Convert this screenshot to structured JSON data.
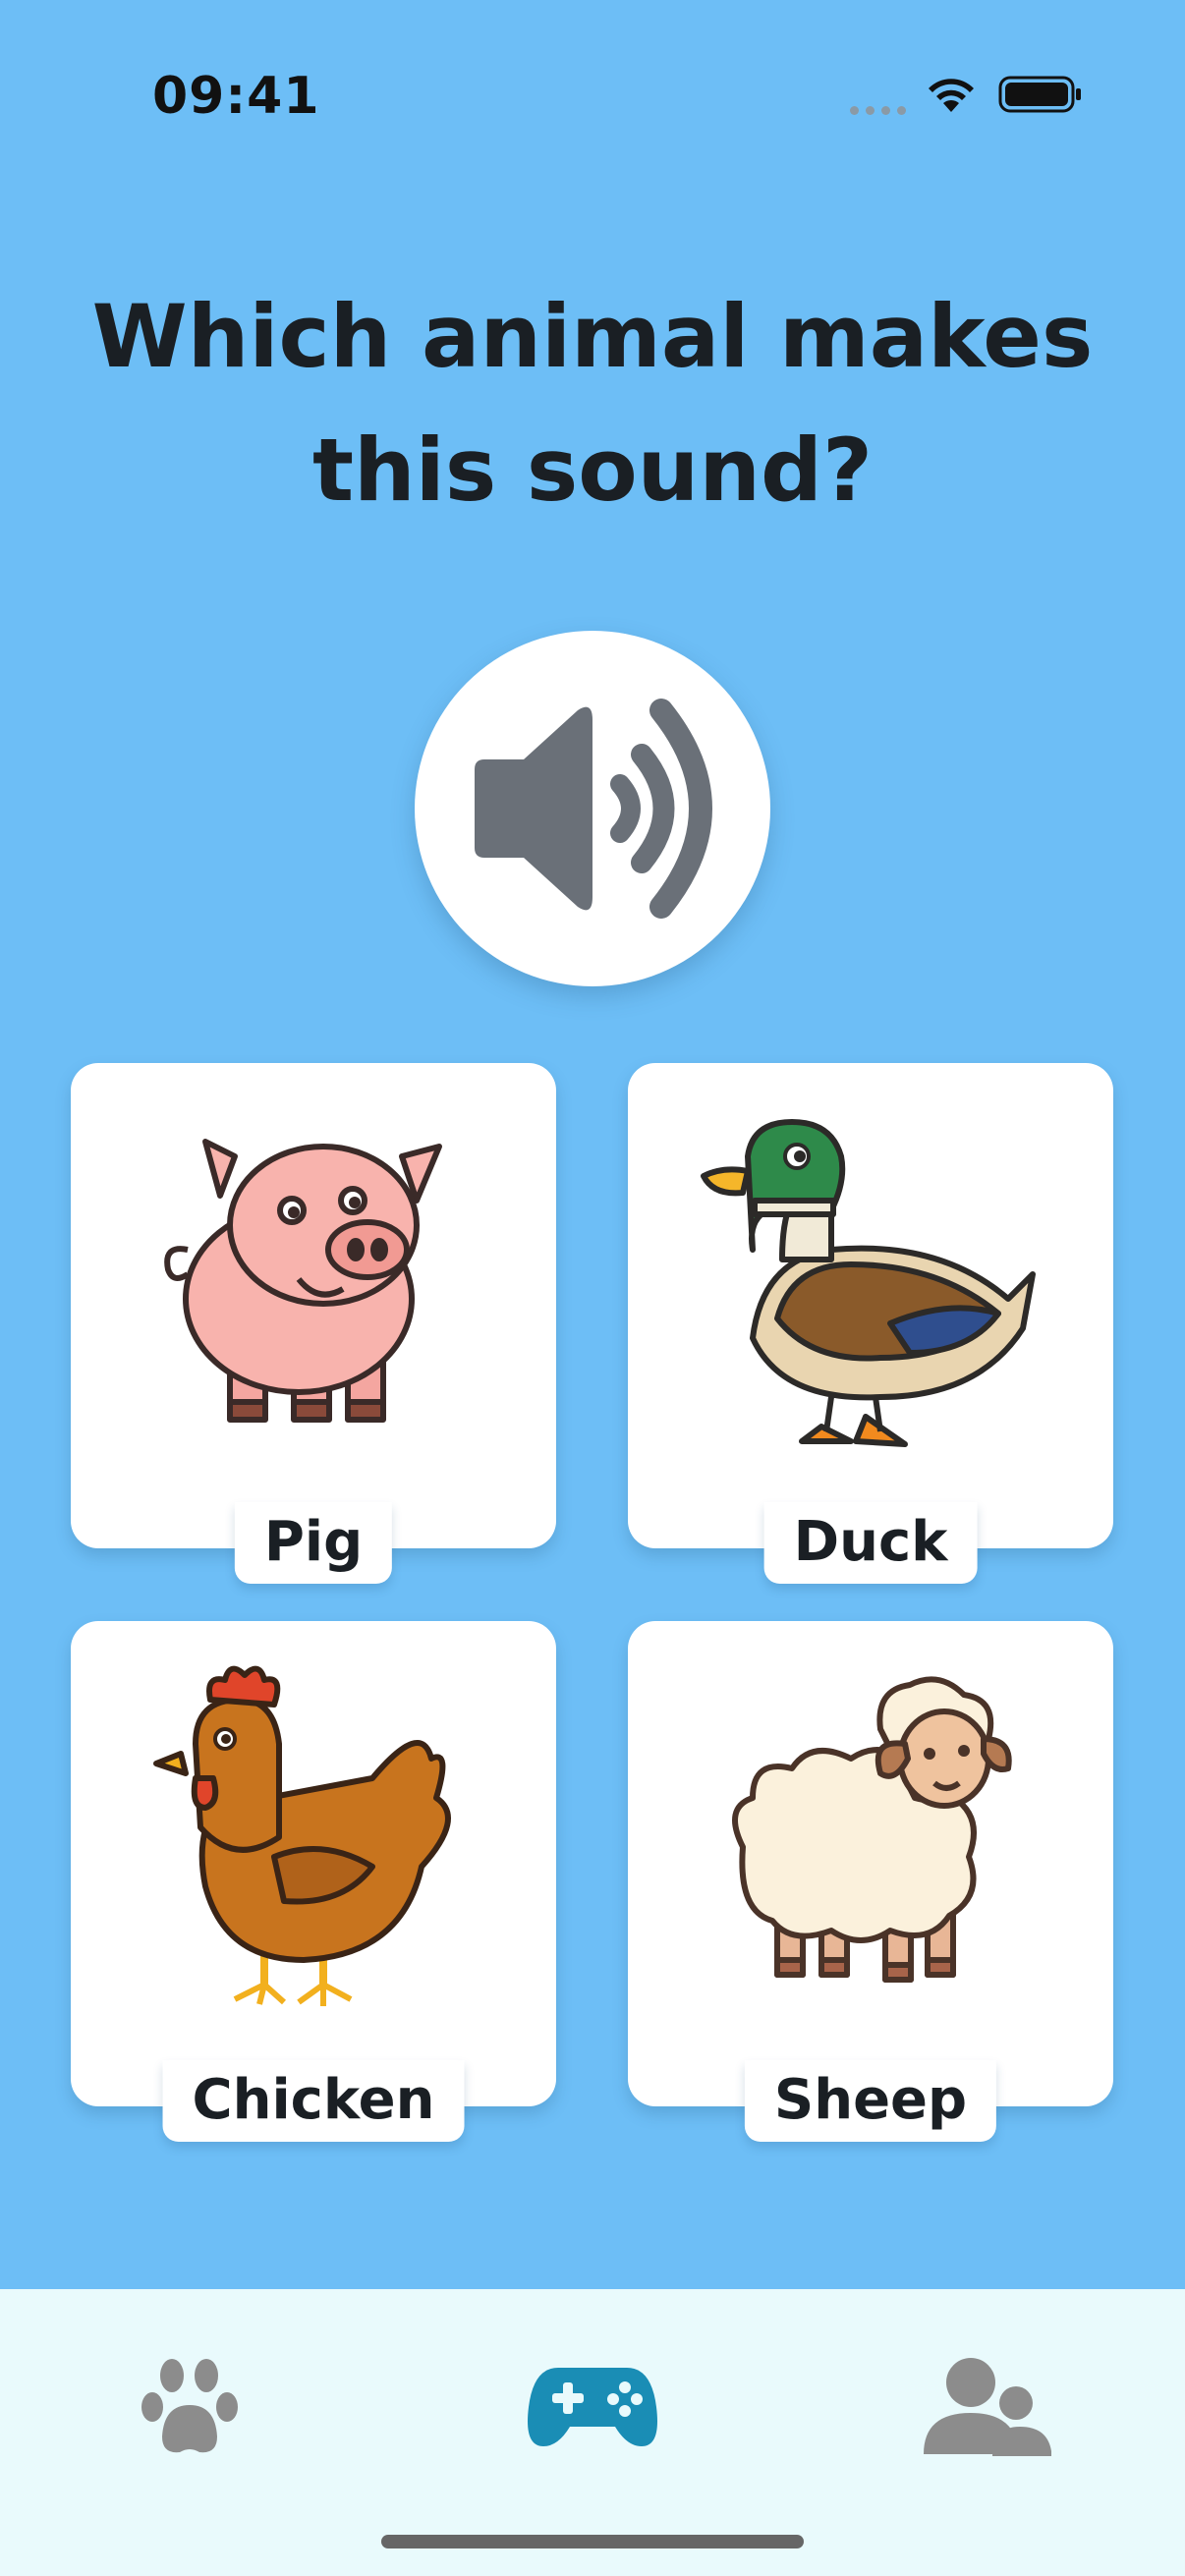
{
  "status_bar": {
    "time": "09:41",
    "icons": [
      "cellular-dots-icon",
      "wifi-icon",
      "battery-icon"
    ]
  },
  "question": {
    "title": "Which animal makes this sound?"
  },
  "sound_button": {
    "icon": "speaker-icon"
  },
  "choices": [
    {
      "label": "Pig",
      "icon": "pig-icon"
    },
    {
      "label": "Duck",
      "icon": "duck-icon"
    },
    {
      "label": "Chicken",
      "icon": "chicken-icon"
    },
    {
      "label": "Sheep",
      "icon": "sheep-icon"
    }
  ],
  "tab_bar": {
    "tabs": [
      {
        "icon": "paw-icon",
        "active": false
      },
      {
        "icon": "gamepad-icon",
        "active": true
      },
      {
        "icon": "users-icon",
        "active": false
      }
    ],
    "active_color": "#1A8DB5",
    "inactive_color": "#8C8C8C"
  },
  "colors": {
    "background": "#6DBEF6",
    "card": "#FFFFFF",
    "tab_bar": "#E9FAFC",
    "text": "#1A1F24"
  }
}
